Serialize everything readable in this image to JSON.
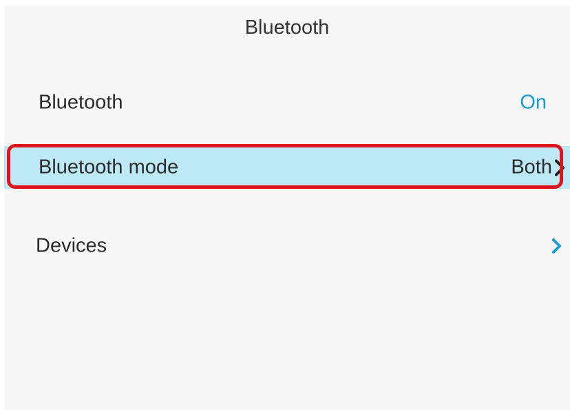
{
  "header": {
    "title": "Bluetooth"
  },
  "settings": [
    {
      "label": "Bluetooth",
      "value": "On"
    },
    {
      "label": "Bluetooth mode",
      "value": "Both",
      "icon": "chevron-right-icon",
      "selected": true
    },
    {
      "label": "Devices",
      "value": "",
      "icon": "chevron-right-icon"
    }
  ],
  "colors": {
    "value_accent": "#1a9ad6",
    "selected_row_bg": "#bde9f6",
    "highlight_border": "#e0121b",
    "screen_bg": "#f7f7f7"
  }
}
